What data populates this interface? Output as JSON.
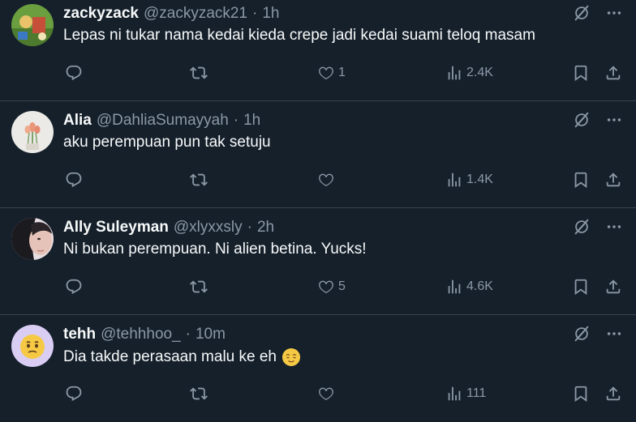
{
  "tweets": [
    {
      "name": "zackyzack",
      "handle": "@zackyzack21",
      "separator": "·",
      "time": "1h",
      "text": "Lepas ni tukar nama kedai kieda crepe jadi kedai suami teloq masam",
      "likes": "1",
      "views": "2.4K"
    },
    {
      "name": "Alia",
      "handle": "@DahliaSumayyah",
      "separator": "·",
      "time": "1h",
      "text": "aku perempuan pun tak setuju",
      "likes": "",
      "views": "1.4K"
    },
    {
      "name": "Ally Suleyman",
      "handle": "@xlyxxsly",
      "separator": "·",
      "time": "2h",
      "text": "Ni bukan perempuan. Ni alien betina. Yucks!",
      "likes": "5",
      "views": "4.6K"
    },
    {
      "name": "tehh",
      "handle": "@tehhhoo_",
      "separator": "·",
      "time": "10m",
      "text": "Dia takde perasaan malu ke eh",
      "likes": "",
      "views": "111"
    }
  ],
  "icons": {
    "reply": "reply-icon",
    "retweet": "retweet-icon",
    "like": "heart-icon",
    "views": "views-chart-icon",
    "bookmark": "bookmark-icon",
    "share": "share-icon",
    "grok": "grok-icon",
    "more": "more-icon"
  },
  "colors": {
    "background": "#15202b",
    "divider": "#38444d",
    "muted": "#8b98a5",
    "text": "#f7f9f9"
  }
}
